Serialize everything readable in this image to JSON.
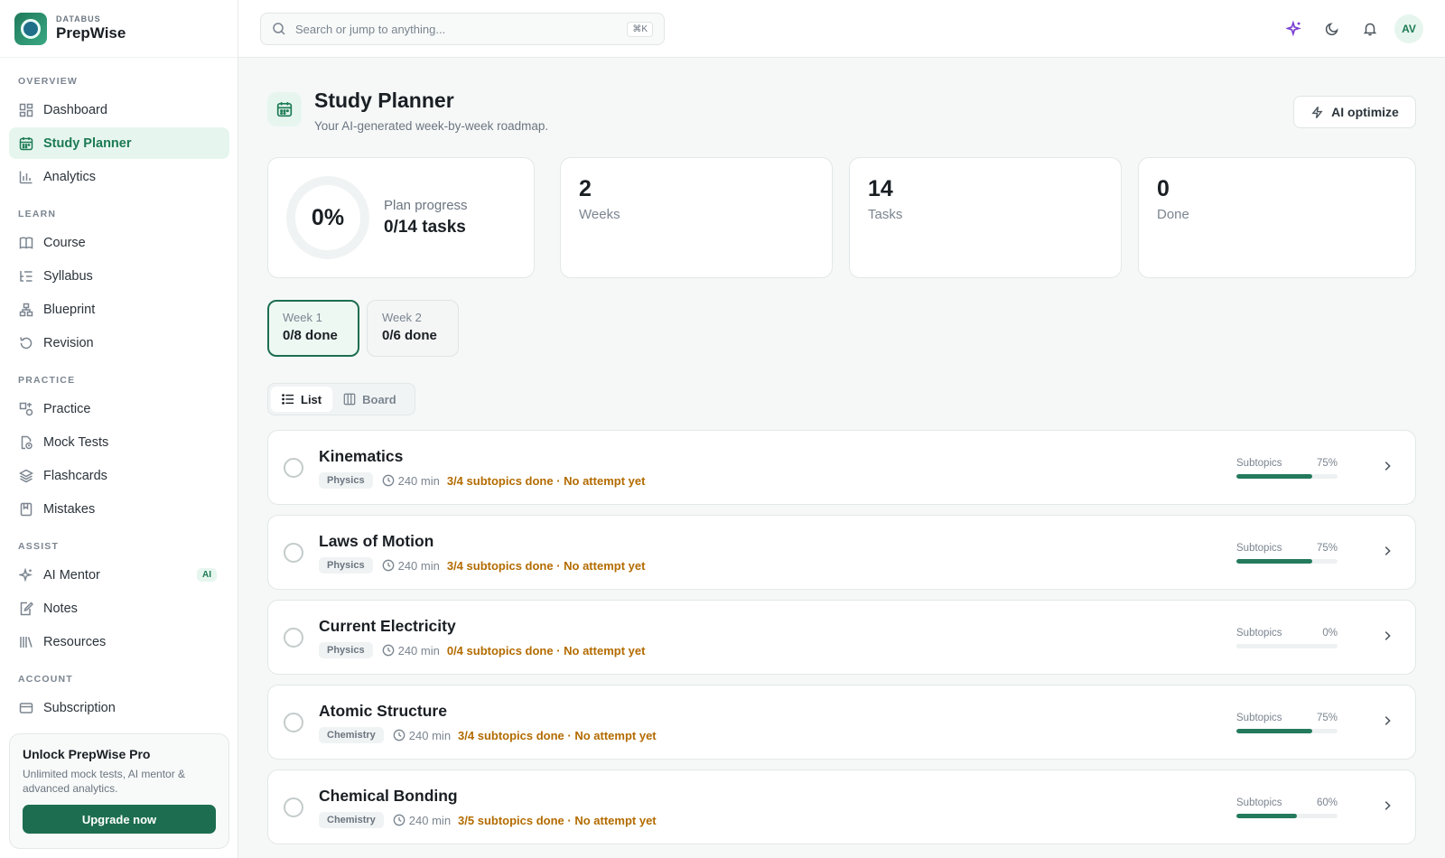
{
  "brand": {
    "small": "DATABUS",
    "name": "PrepWise"
  },
  "sidebar": {
    "sections": [
      "OVERVIEW",
      "LEARN",
      "PRACTICE",
      "ASSIST",
      "ACCOUNT"
    ],
    "items": [
      {
        "label": "Dashboard",
        "icon": "dashboard-icon"
      },
      {
        "label": "Study Planner",
        "icon": "calendar-icon",
        "active": true
      },
      {
        "label": "Analytics",
        "icon": "bar-chart-icon"
      },
      {
        "label": "Course",
        "icon": "book-icon"
      },
      {
        "label": "Syllabus",
        "icon": "list-tree-icon"
      },
      {
        "label": "Blueprint",
        "icon": "hierarchy-icon"
      },
      {
        "label": "Revision",
        "icon": "rotate-icon"
      },
      {
        "label": "Practice",
        "icon": "shapes-icon"
      },
      {
        "label": "Mock Tests",
        "icon": "file-clock-icon"
      },
      {
        "label": "Flashcards",
        "icon": "layers-icon"
      },
      {
        "label": "Mistakes",
        "icon": "bookmark-icon"
      },
      {
        "label": "AI Mentor",
        "icon": "sparkles-icon",
        "badge": "AI"
      },
      {
        "label": "Notes",
        "icon": "notebook-pen-icon"
      },
      {
        "label": "Resources",
        "icon": "library-icon"
      },
      {
        "label": "Subscription",
        "icon": "credit-card-icon"
      }
    ],
    "promo": {
      "title": "Unlock PrepWise Pro",
      "desc": "Unlimited mock tests, AI mentor & advanced analytics.",
      "button": "Upgrade now"
    }
  },
  "topbar": {
    "search_placeholder": "Search or jump to anything...",
    "shortcut": "⌘K",
    "avatar": "AV"
  },
  "page": {
    "title": "Study Planner",
    "subtitle": "Your AI-generated week-by-week roadmap.",
    "ai_button": "AI optimize"
  },
  "stats": {
    "progress_pct": "0%",
    "progress_label": "Plan progress",
    "progress_value": "0/14 tasks",
    "weeks_num": "2",
    "weeks_label": "Weeks",
    "tasks_num": "14",
    "tasks_label": "Tasks",
    "done_num": "0",
    "done_label": "Done"
  },
  "weeks": [
    {
      "label": "Week 1",
      "value": "0/8 done",
      "active": true
    },
    {
      "label": "Week 2",
      "value": "0/6 done",
      "active": false
    }
  ],
  "view_toggle": {
    "list": "List",
    "board": "Board"
  },
  "tasks": [
    {
      "title": "Kinematics",
      "subject": "Physics",
      "minutes": "240 min",
      "status": "3/4 subtopics done · No attempt yet",
      "sub_label": "Subtopics",
      "pct_text": "75%",
      "pct": 0.75
    },
    {
      "title": "Laws of Motion",
      "subject": "Physics",
      "minutes": "240 min",
      "status": "3/4 subtopics done · No attempt yet",
      "sub_label": "Subtopics",
      "pct_text": "75%",
      "pct": 0.75
    },
    {
      "title": "Current Electricity",
      "subject": "Physics",
      "minutes": "240 min",
      "status": "0/4 subtopics done · No attempt yet",
      "sub_label": "Subtopics",
      "pct_text": "0%",
      "pct": 0
    },
    {
      "title": "Atomic Structure",
      "subject": "Chemistry",
      "minutes": "240 min",
      "status": "3/4 subtopics done · No attempt yet",
      "sub_label": "Subtopics",
      "pct_text": "75%",
      "pct": 0.75
    },
    {
      "title": "Chemical Bonding",
      "subject": "Chemistry",
      "minutes": "240 min",
      "status": "3/5 subtopics done · No attempt yet",
      "sub_label": "Subtopics",
      "pct_text": "60%",
      "pct": 0.6
    }
  ],
  "colors": {
    "accent": "#1d6e50",
    "status": "#b36b00"
  }
}
